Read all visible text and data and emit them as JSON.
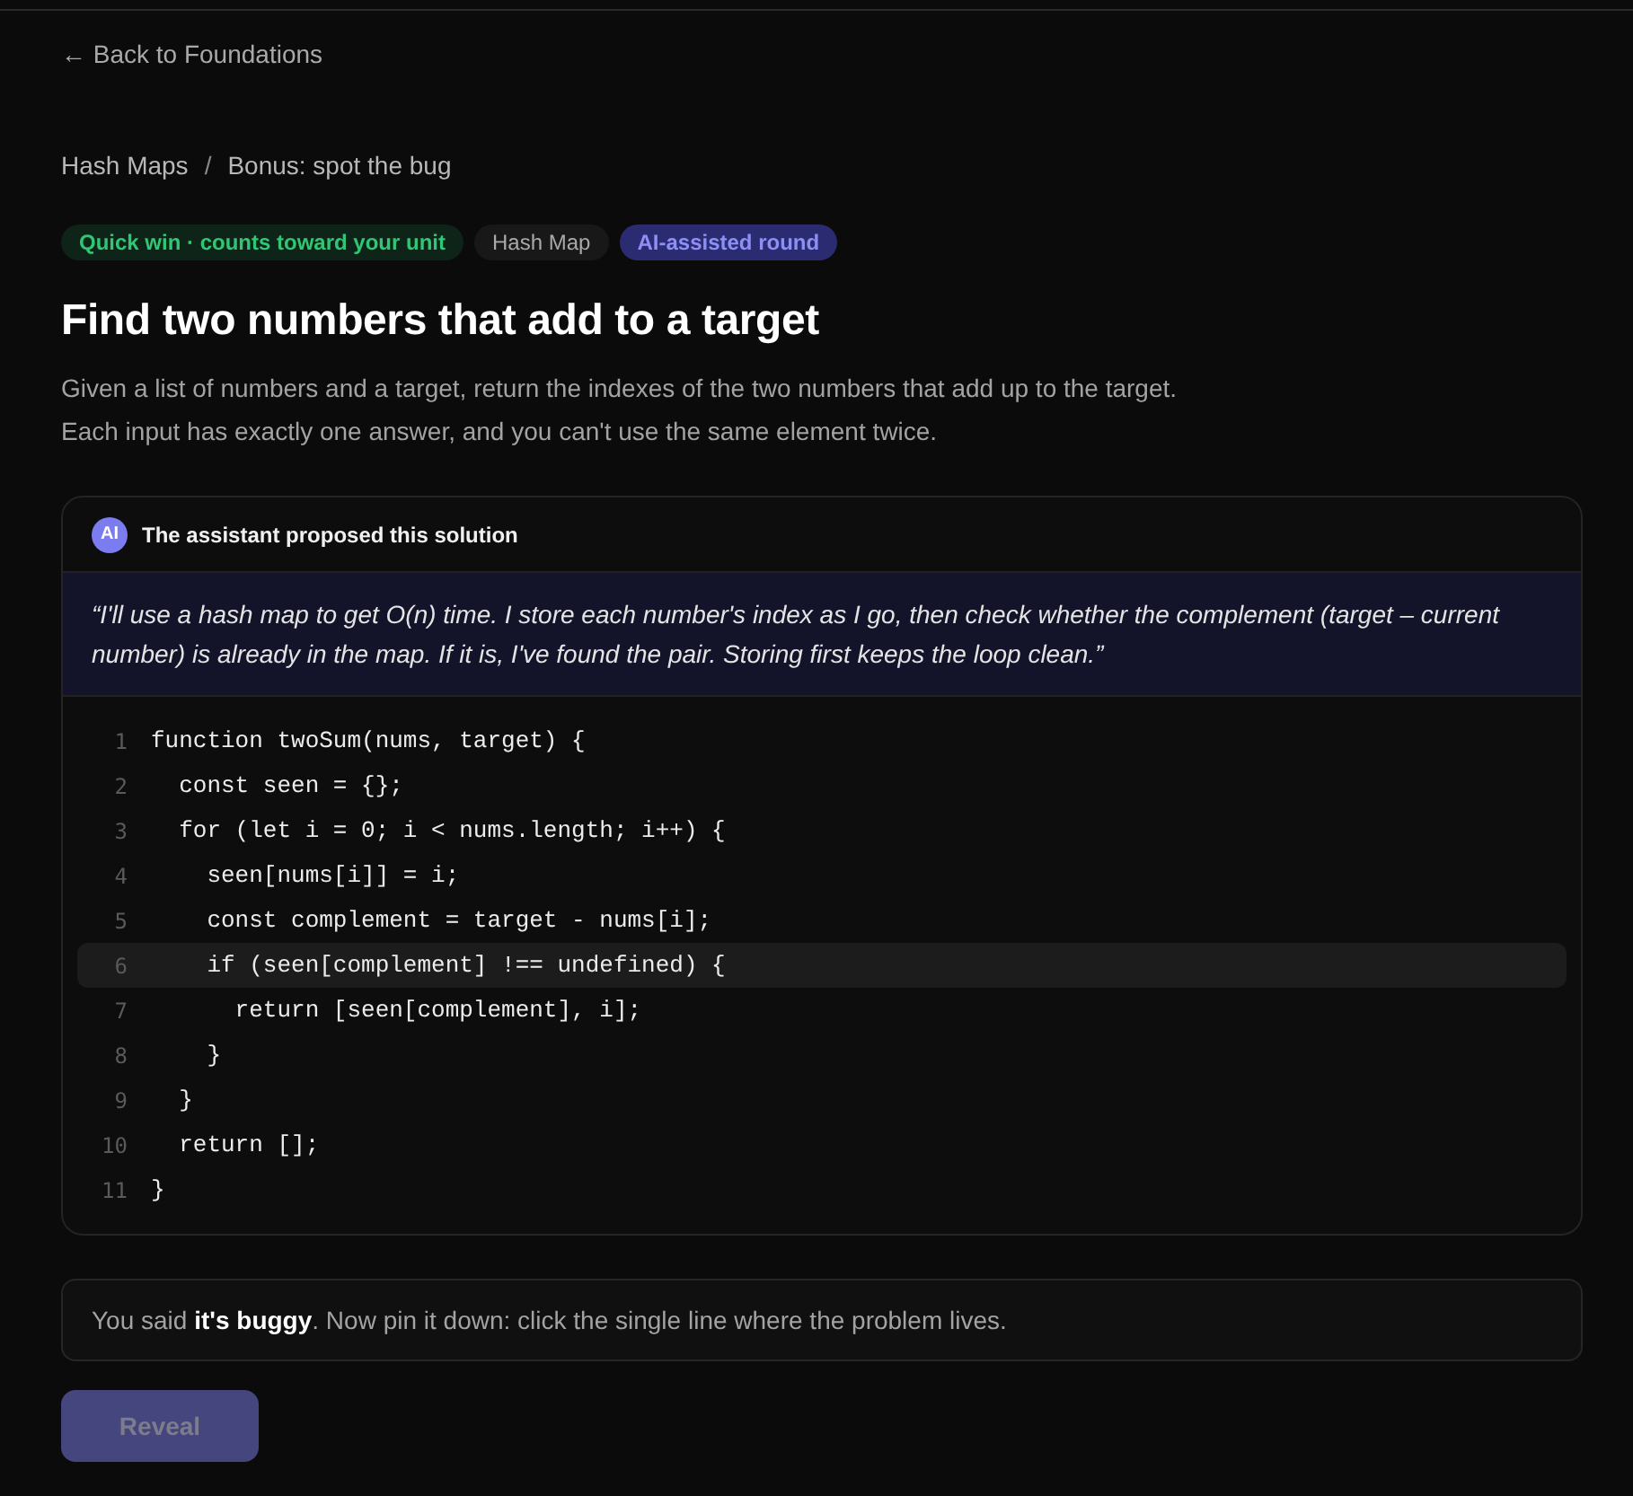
{
  "back_link": {
    "label": "← Back to Foundations"
  },
  "breadcrumb": {
    "items": [
      "Hash Maps",
      "Bonus: spot the bug"
    ],
    "separator": "/"
  },
  "tags": [
    {
      "label": "Quick win · counts toward your unit",
      "kind": "success"
    },
    {
      "label": "Hash Map",
      "kind": "neutral"
    },
    {
      "label": "AI-assisted round",
      "kind": "ai"
    }
  ],
  "title": "Find two numbers that add to a target",
  "description": [
    "Given a list of numbers and a target, return the indexes of the two numbers that add up to the target.",
    "Each input has exactly one answer, and you can't use the same element twice."
  ],
  "proposal": {
    "avatar": "AI",
    "heading": "The assistant proposed this solution",
    "quote": "“I'll use a hash map to get O(n) time. I store each number's index as I go, then check whether the complement (target – current number) is already in the map. If it is, I've found the pair. Storing first keeps the loop clean.”",
    "code_lines": [
      {
        "number": "1",
        "code": "function twoSum(nums, target) {",
        "selected": false
      },
      {
        "number": "2",
        "code": "  const seen = {};",
        "selected": false
      },
      {
        "number": "3",
        "code": "  for (let i = 0; i < nums.length; i++) {",
        "selected": false
      },
      {
        "number": "4",
        "code": "    seen[nums[i]] = i;",
        "selected": false
      },
      {
        "number": "5",
        "code": "    const complement = target - nums[i];",
        "selected": false
      },
      {
        "number": "6",
        "code": "    if (seen[complement] !== undefined) {",
        "selected": true
      },
      {
        "number": "7",
        "code": "      return [seen[complement], i];",
        "selected": false
      },
      {
        "number": "8",
        "code": "    }",
        "selected": false
      },
      {
        "number": "9",
        "code": "  }",
        "selected": false
      },
      {
        "number": "10",
        "code": "  return [];",
        "selected": false
      },
      {
        "number": "11",
        "code": "}",
        "selected": false
      }
    ]
  },
  "hint": "You said **it's buggy**. Now pin it down: click the single line where the problem lives.",
  "reveal_button": {
    "label": "Reveal",
    "disabled": true
  }
}
